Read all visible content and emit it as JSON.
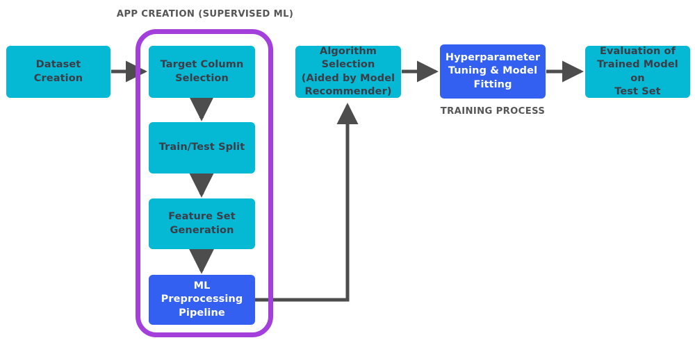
{
  "diagram": {
    "title_group_label": "APP CREATION (SUPERVISED ML)",
    "training_group_label": "TRAINING PROCESS",
    "colors": {
      "cyan_node": "#05b8d4",
      "blue_node": "#3360f0",
      "purple_container": "#a33fdb",
      "arrow": "#4d4d4d",
      "label_text": "#565656",
      "cyan_node_text": "#3d3d47",
      "blue_node_text": "#ffffff",
      "background": "#ffffff"
    },
    "nodes": [
      {
        "id": "dataset-creation",
        "label": "Dataset Creation",
        "style": "cyan"
      },
      {
        "id": "target-column-selection",
        "label": "Target Column\nSelection",
        "style": "cyan"
      },
      {
        "id": "train-test-split",
        "label": "Train/Test Split",
        "style": "cyan"
      },
      {
        "id": "feature-set-generation",
        "label": "Feature Set\nGeneration",
        "style": "cyan"
      },
      {
        "id": "ml-preprocessing-pipeline",
        "label": "ML Preprocessing\nPipeline",
        "style": "blue"
      },
      {
        "id": "algorithm-selection",
        "label": "Algorithm Selection\n(Aided by Model\nRecommender)",
        "style": "cyan"
      },
      {
        "id": "hyperparameter-tuning",
        "label": "Hyperparameter\nTuning & Model\nFitting",
        "style": "blue"
      },
      {
        "id": "evaluation-trained-model",
        "label": "Evaluation of\nTrained Model on\nTest Set",
        "style": "cyan"
      }
    ],
    "edges": [
      {
        "from": "dataset-creation",
        "to": "target-column-selection"
      },
      {
        "from": "target-column-selection",
        "to": "train-test-split"
      },
      {
        "from": "train-test-split",
        "to": "feature-set-generation"
      },
      {
        "from": "feature-set-generation",
        "to": "ml-preprocessing-pipeline"
      },
      {
        "from": "ml-preprocessing-pipeline",
        "to": "algorithm-selection"
      },
      {
        "from": "algorithm-selection",
        "to": "hyperparameter-tuning"
      },
      {
        "from": "hyperparameter-tuning",
        "to": "evaluation-trained-model"
      }
    ]
  }
}
